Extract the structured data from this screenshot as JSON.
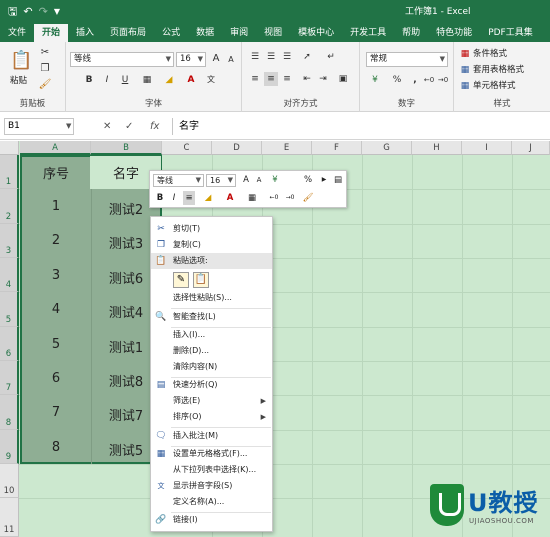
{
  "window": {
    "title": "工作簿1 - Excel"
  },
  "quick_access": {
    "save_icon": "save-icon",
    "undo_icon": "undo-icon",
    "redo_icon": "redo-icon",
    "more_icon": "customize-icon"
  },
  "tabs": [
    "文件",
    "开始",
    "插入",
    "页面布局",
    "公式",
    "数据",
    "审阅",
    "视图",
    "模板中心",
    "开发工具",
    "帮助",
    "特色功能",
    "PDF工具集"
  ],
  "active_tab": "开始",
  "ribbon": {
    "clipboard": {
      "label": "剪贴板",
      "paste": "粘贴"
    },
    "font": {
      "label": "字体",
      "name": "等线",
      "size": "16",
      "bold": "B",
      "italic": "I",
      "underline": "U",
      "grow": "A",
      "shrink": "A"
    },
    "alignment": {
      "label": "对齐方式"
    },
    "number": {
      "label": "数字",
      "format": "常规",
      "percent": "%",
      "comma": ","
    },
    "styles": {
      "label": "样式",
      "conditional": "条件格式",
      "table": "套用表格格式",
      "cell": "单元格样式"
    }
  },
  "formula_bar": {
    "name_box": "B1",
    "fx": "fx",
    "value": "名字"
  },
  "columns": [
    "A",
    "B",
    "C",
    "D",
    "E",
    "F",
    "G",
    "H",
    "I",
    "J"
  ],
  "rows": [
    "1",
    "2",
    "3",
    "4",
    "5",
    "6",
    "7",
    "8",
    "9",
    "10",
    "11"
  ],
  "cells": {
    "A1": "序号",
    "B1": "名字",
    "A2": "1",
    "B2": "测试2",
    "A3": "2",
    "B3": "测试3",
    "A4": "3",
    "B4": "测试6",
    "A5": "4",
    "B5": "测试4",
    "A6": "5",
    "B6": "测试1",
    "A7": "6",
    "B7": "测试8",
    "A8": "7",
    "B8": "测试7",
    "A9": "8",
    "B9": "测试5"
  },
  "mini_toolbar": {
    "font": "等线",
    "size": "16",
    "bold": "B",
    "italic": "I",
    "percent": "%"
  },
  "context_menu": {
    "cut": "剪切(T)",
    "copy": "复制(C)",
    "paste_options": "粘贴选项:",
    "paste_special": "选择性粘贴(S)...",
    "smart_lookup": "智能查找(L)",
    "insert": "插入(I)...",
    "delete": "删除(D)...",
    "clear": "清除内容(N)",
    "quick_analysis": "快速分析(Q)",
    "filter": "筛选(E)",
    "sort": "排序(O)",
    "insert_comment": "插入批注(M)",
    "format_cells": "设置单元格格式(F)...",
    "pick_list": "从下拉列表中选择(K)...",
    "phonetic": "显示拼音字段(S)",
    "define_name": "定义名称(A)...",
    "link": "链接(I)"
  },
  "watermark": {
    "brand": "U教授",
    "url": "UJIAOSHOU.COM"
  },
  "colors": {
    "excel_green": "#217346",
    "sheet_bg": "#cce8cf",
    "selection": "#8fae94"
  }
}
